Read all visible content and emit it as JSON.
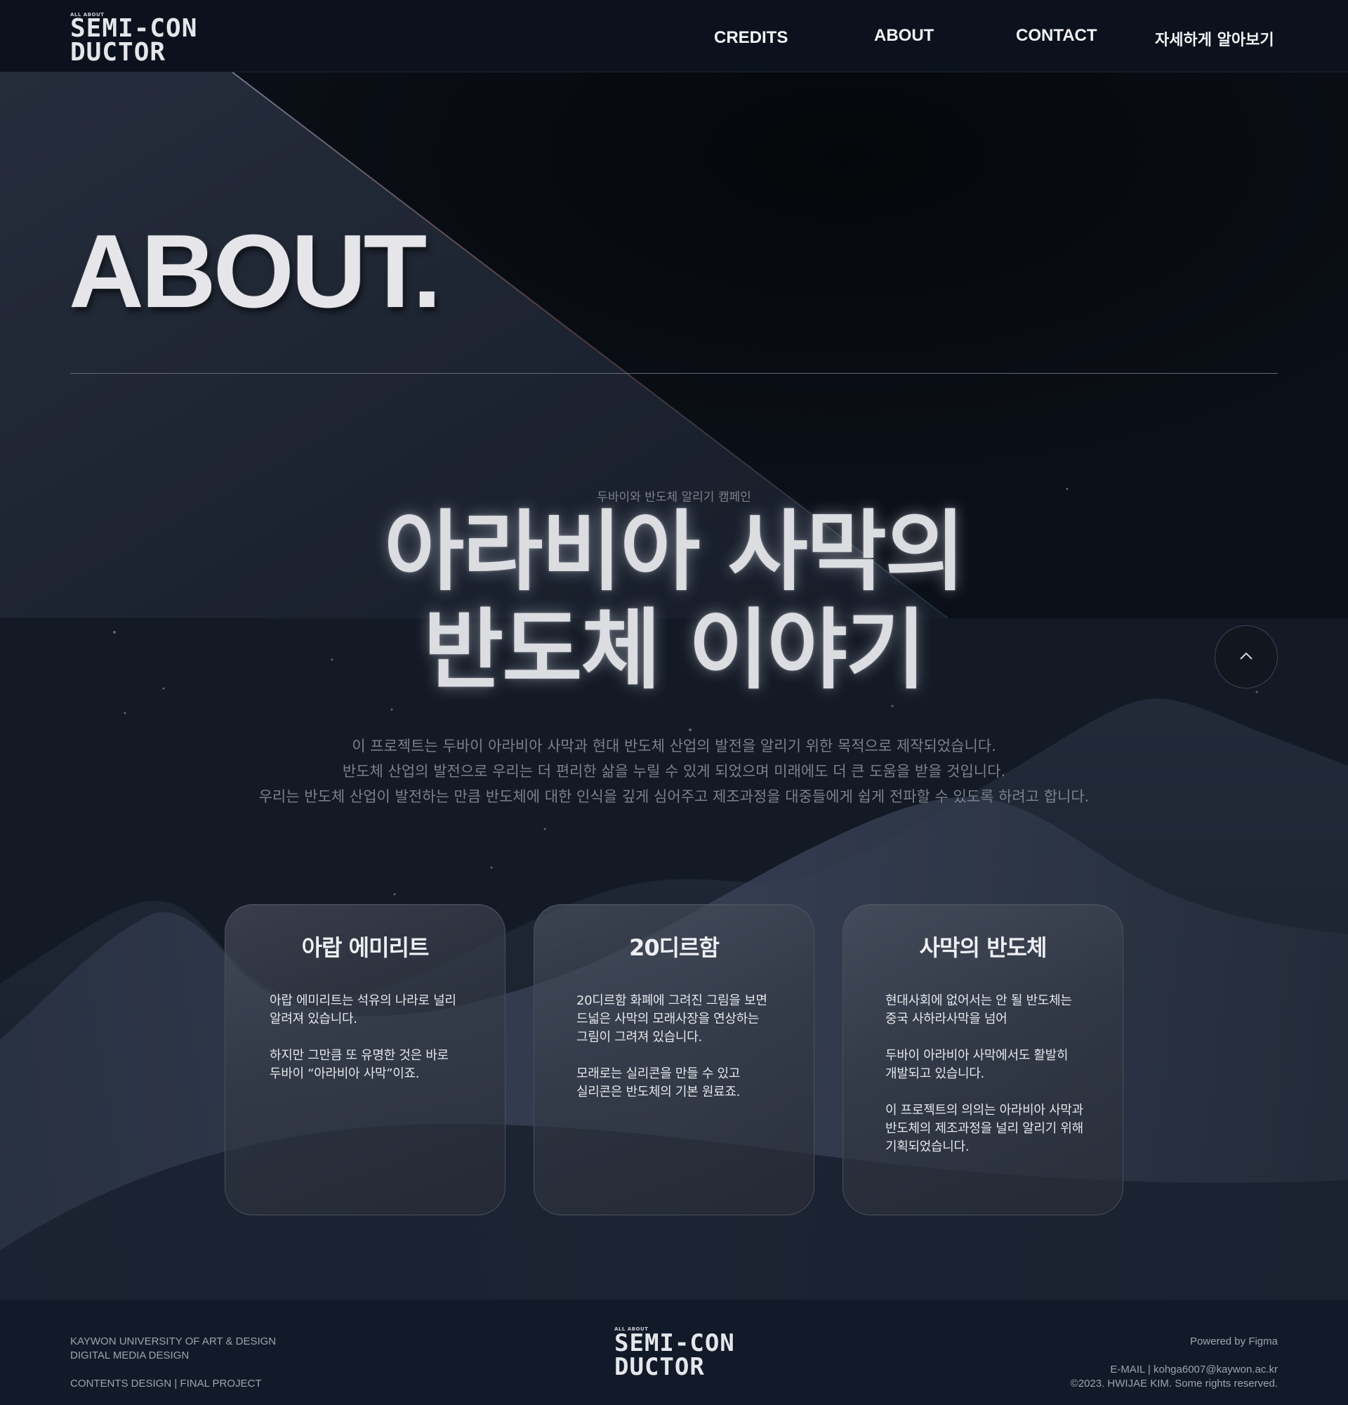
{
  "header": {
    "logo": {
      "small": "ALL ABOUT",
      "line1": "SEMI-CON",
      "line2": "DUCTOR"
    },
    "nav": [
      "CREDITS",
      "ABOUT",
      "CONTACT",
      "자세하게 알아보기"
    ]
  },
  "about": {
    "title": "ABOUT."
  },
  "hero": {
    "subtitle": "두바이와 반도체 알리기 캠페인",
    "title_line1": "아라비아 사막의",
    "title_line2": "반도체 이야기",
    "description": [
      "이 프로젝트는 두바이 아라비아 사막과 현대 반도체 산업의 발전을 알리기 위한 목적으로 제작되었습니다.",
      "반도체 산업의 발전으로 우리는 더 편리한 삶을 누릴 수 있게 되었으며 미래에도 더 큰 도움을 받을 것입니다.",
      "우리는 반도체 산업이 발전하는 만큼 반도체에 대한 인식을 깊게 심어주고 제조과정을 대중들에게 쉽게 전파할 수 있도록 하려고 합니다."
    ]
  },
  "cards": [
    {
      "title": "아랍 에미리트",
      "paragraphs": [
        "아랍 에미리트는 석유의 나라로 널리\n알려져 있습니다.",
        "하지만 그만큼 또 유명한 것은 바로\n두바이 “아라비아 사막”이죠."
      ]
    },
    {
      "title": "20디르함",
      "paragraphs": [
        "20디르함 화폐에 그려진 그림을 보면\n드넓은 사막의 모래사장을 연상하는\n그림이 그려져 있습니다.",
        "모래로는 실리콘을 만들 수 있고\n실리콘은 반도체의 기본 원료죠."
      ]
    },
    {
      "title": "사막의 반도체",
      "paragraphs": [
        "현대사회에 없어서는 안 될 반도체는\n중국 사하라사막을 넘어",
        "두바이 아라비아 사막에서도 활발히\n개발되고 있습니다.",
        "이 프로젝트의 의의는 아라비아 사막과\n반도체의 제조과정을 널리 알리기 위해\n기획되었습니다."
      ]
    }
  ],
  "footer": {
    "left": [
      "KAYWON UNIVERSITY OF ART & DESIGN",
      "DIGITAL MEDIA DESIGN",
      "CONTENTS DESIGN | FINAL PROJECT"
    ],
    "logo": {
      "small": "ALL ABOUT",
      "line1": "SEMI-CON",
      "line2": "DUCTOR"
    },
    "powered": "Powered by Figma",
    "email": "E-MAIL | kohga6007@kaywon.ac.kr",
    "copyright": "©2023. HWIJAE KIM. Some rights reserved."
  },
  "colors": {
    "background": "#10151f",
    "header": "#0d121d",
    "footer": "#121a2a",
    "text": "#d9dbe0"
  },
  "icons": {
    "scroll_top": "chevron-up-icon"
  }
}
